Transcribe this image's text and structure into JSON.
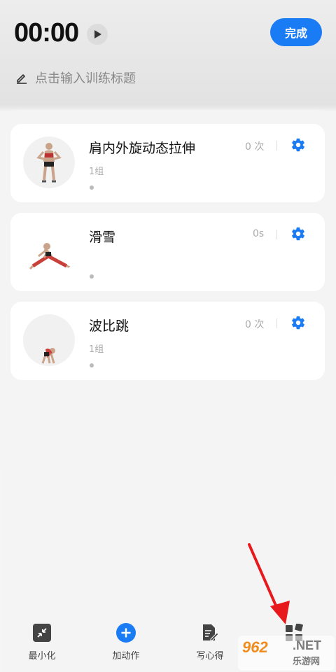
{
  "header": {
    "timer": "00:00",
    "done_label": "完成",
    "title_placeholder": "点击输入训练标题"
  },
  "exercises": [
    {
      "name": "肩内外旋动态拉伸",
      "sub": "1组",
      "count": "0 次"
    },
    {
      "name": "滑雪",
      "sub": "",
      "count": "0s"
    },
    {
      "name": "波比跳",
      "sub": "1组",
      "count": "0 次"
    }
  ],
  "bottom_nav": {
    "items": [
      {
        "label": "最小化",
        "icon": "minimize-icon"
      },
      {
        "label": "加动作",
        "icon": "add-circle-icon"
      },
      {
        "label": "写心得",
        "icon": "note-edit-icon"
      },
      {
        "label": "",
        "icon": "grid-icon"
      }
    ]
  },
  "watermark": {
    "brand_num": "962",
    "brand_net": ".NET",
    "brand_cn": "乐游网"
  },
  "colors": {
    "accent": "#1a7cf5",
    "arrow": "#e8191c"
  }
}
